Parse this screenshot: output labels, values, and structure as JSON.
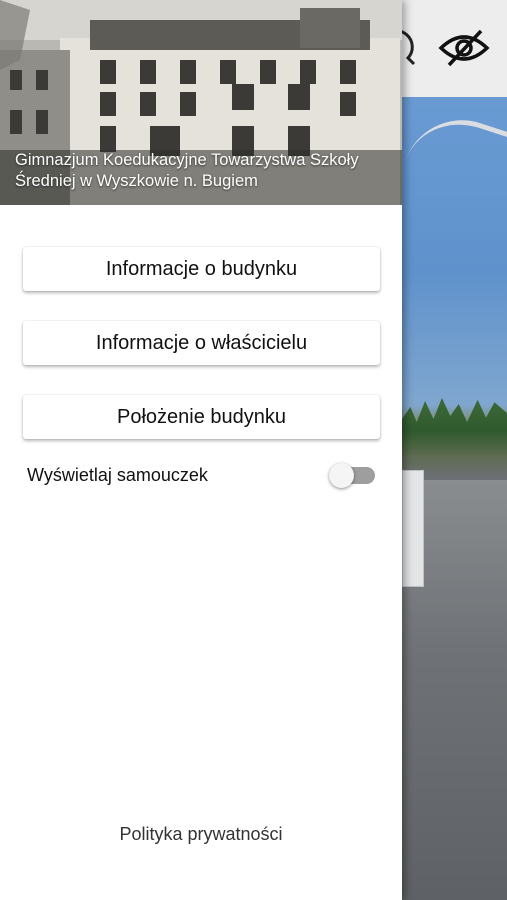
{
  "drawer": {
    "header_title": "Gimnazjum Koedukacyjne Towarzystwa Szkoły Średniej w Wyszkowie n. Bugiem",
    "menu": [
      {
        "label": "Informacje o budynku"
      },
      {
        "label": "Informacje o właścicielu"
      },
      {
        "label": "Położenie budynku"
      }
    ],
    "toggle": {
      "label": "Wyświetlaj samouczek",
      "on": false
    },
    "footer_link": "Polityka prywatności"
  },
  "app_bar": {
    "icons": [
      "hide-eye-icon",
      "partial-icon"
    ]
  },
  "colors": {
    "drawer_bg": "#ffffff",
    "switch_track_off": "#9e9e9e",
    "switch_thumb_off": "#f5f5f5"
  }
}
